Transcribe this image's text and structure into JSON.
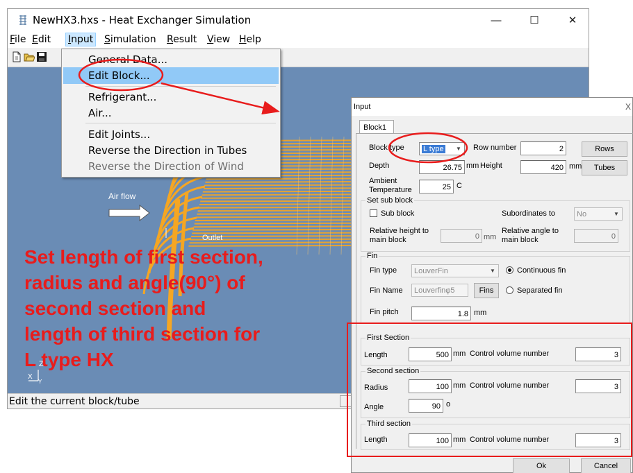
{
  "window": {
    "title": "NewHX3.hxs - Heat Exchanger Simulation",
    "controls": {
      "minimize": "—",
      "maximize": "☐",
      "close": "✕"
    }
  },
  "menubar": {
    "items": [
      {
        "first": "F",
        "rest": "ile"
      },
      {
        "first": "E",
        "rest": "dit"
      },
      {
        "first": "I",
        "rest": "nput"
      },
      {
        "first": "S",
        "rest": "imulation"
      },
      {
        "first": "R",
        "rest": "esult"
      },
      {
        "first": "V",
        "rest": "iew"
      },
      {
        "first": "H",
        "rest": "elp"
      }
    ]
  },
  "toolbar": {
    "icons": [
      "new-file-icon",
      "open-folder-icon",
      "save-disk-icon"
    ]
  },
  "input_menu": {
    "items": [
      {
        "label": "General Data..."
      },
      {
        "label": "Edit Block..."
      },
      {
        "label": "Refrigerant..."
      },
      {
        "label": "Air..."
      },
      {
        "label": "Edit Joints..."
      },
      {
        "label": "Reverse the Direction in Tubes"
      },
      {
        "label": "Reverse the Direction of Wind"
      }
    ]
  },
  "viewport": {
    "air_flow_label": "Air flow",
    "outlet_label": "Outlet",
    "axis_z": "Z",
    "axis_x": "X",
    "axis_y": "Y"
  },
  "statusbar": {
    "text": "Edit the current block/tube"
  },
  "dialog": {
    "title": "Input",
    "close": "X",
    "tab": "Block1",
    "block_type_label": "Block type",
    "block_type_value": "L type",
    "row_number_label": "Row number",
    "row_number_value": "2",
    "rows_button": "Rows",
    "depth_label": "Depth",
    "depth_value": "26.75",
    "depth_unit": "mm",
    "height_label": "Height",
    "height_value": "420",
    "height_unit": "mm",
    "tubes_button": "Tubes",
    "ambient_label_1": "Ambient",
    "ambient_label_2": "Temperature",
    "ambient_value": "25",
    "ambient_unit": "C",
    "sub_block_group": "Set sub block",
    "sub_block_label": "Sub block",
    "subordinates_label": "Subordinates to",
    "subordinates_value": "No",
    "rel_height_label_1": "Relative height to",
    "rel_height_label_2": "main block",
    "rel_height_value": "0",
    "rel_height_unit": "mm",
    "rel_angle_label_1": "Relative angle to",
    "rel_angle_label_2": "main block",
    "rel_angle_value": "0",
    "fin_group": "Fin",
    "fin_type_label": "Fin type",
    "fin_type_value": "LouverFin",
    "continuous_fin_label": "Continuous fin",
    "fin_name_label": "Fin Name",
    "fin_name_value": "Louverfinφ5",
    "fins_button": "Fins",
    "separated_fin_label": "Separated fin",
    "fin_pitch_label": "Fin pitch",
    "fin_pitch_value": "1.8",
    "fin_pitch_unit": "mm",
    "first_section": {
      "title": "First Section",
      "length_label": "Length",
      "length_value": "500",
      "length_unit": "mm",
      "cv_label": "Control volume number",
      "cv_value": "3"
    },
    "second_section": {
      "title": "Second section",
      "radius_label": "Radius",
      "radius_value": "100",
      "radius_unit": "mm",
      "cv_label": "Control volume number",
      "cv_value": "3",
      "angle_label": "Angle",
      "angle_value": "90",
      "angle_unit": "o"
    },
    "third_section": {
      "title": "Third section",
      "length_label": "Length",
      "length_value": "100",
      "length_unit": "mm",
      "cv_label": "Control volume number",
      "cv_value": "3"
    },
    "ok_button": "Ok",
    "cancel_button": "Cancel"
  },
  "annotation": {
    "text": "Set length of first section,\nradius and angle(90°) of\nsecond section and\nlength of third section for\nL type HX",
    "color": "#e81c1c"
  },
  "colors": {
    "viewport_bg": "#6a8cb5",
    "tube": "#f5a623",
    "highlight": "#91c9f7",
    "annotation_red": "#e81c1c"
  }
}
